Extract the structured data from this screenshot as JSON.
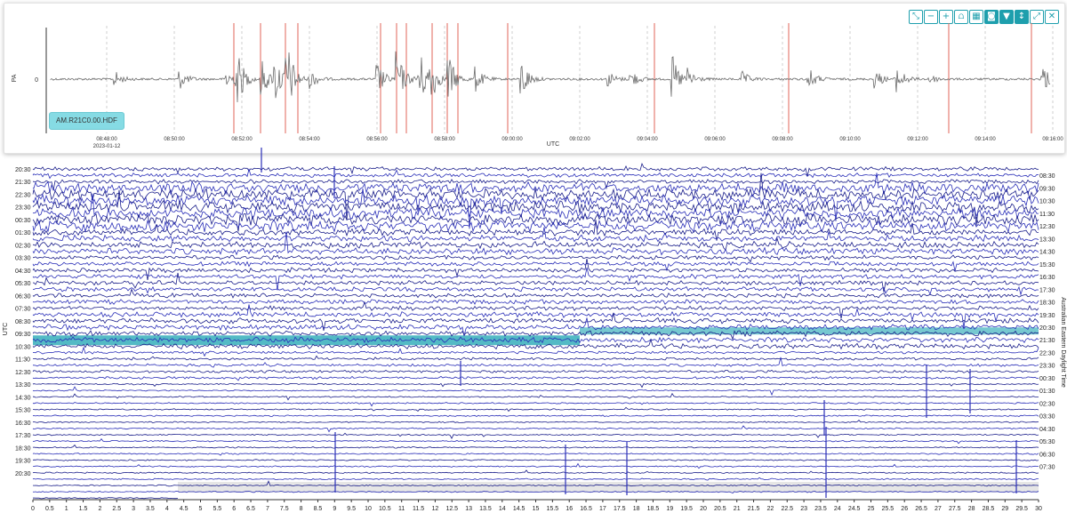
{
  "toolbar": {
    "buttons": [
      {
        "icon": "fit-icon",
        "glyph": "⤡",
        "active": false
      },
      {
        "icon": "zoom-out-icon",
        "glyph": "−",
        "active": false
      },
      {
        "icon": "zoom-in-icon",
        "glyph": "+",
        "active": false
      },
      {
        "icon": "chart-icon",
        "glyph": "⩍",
        "active": false
      },
      {
        "icon": "grid-icon",
        "glyph": "▦",
        "active": false
      },
      {
        "icon": "headphones-icon",
        "glyph": "◙",
        "active": true
      },
      {
        "icon": "filter-icon",
        "glyph": "▼",
        "active": true
      },
      {
        "icon": "vertical-scale-icon",
        "glyph": "↕",
        "active": true
      },
      {
        "icon": "expand-icon",
        "glyph": "⤢",
        "active": false
      },
      {
        "icon": "close-icon",
        "glyph": "✕",
        "active": false
      }
    ]
  },
  "trace": {
    "ylabel": "PA",
    "ytick": "0",
    "xlabel": "UTC",
    "station": "AM.R21C0.00.HDF",
    "date": "2023-01-12",
    "time_ticks": [
      "08:48:00",
      "08:50:00",
      "08:52:00",
      "08:54:00",
      "08:56:00",
      "08:58:00",
      "09:00:00",
      "09:02:00",
      "09:04:00",
      "09:06:00",
      "09:08:00",
      "09:10:00",
      "09:12:00",
      "09:14:00",
      "09:16:00"
    ],
    "colors": {
      "trace": "#6b6b6b",
      "event_line": "#e2645a",
      "grid": "#cfcfcf"
    }
  },
  "helicorder": {
    "left_axis_label": "UTC",
    "right_axis_label": "Australian Eastern Daylight Time",
    "left_labels": [
      "20:30",
      "21:30",
      "22:30",
      "23:30",
      "00:30",
      "01:30",
      "02:30",
      "03:30",
      "04:30",
      "05:30",
      "06:30",
      "07:30",
      "08:30",
      "09:30",
      "10:30",
      "11:30",
      "12:30",
      "13:30",
      "14:30",
      "15:30",
      "16:30",
      "17:30",
      "18:30",
      "19:30",
      "20:30"
    ],
    "right_labels": [
      "08:30",
      "09:30",
      "10:30",
      "11:30",
      "12:30",
      "13:30",
      "14:30",
      "15:30",
      "16:30",
      "17:30",
      "18:30",
      "19:30",
      "20:30",
      "21:30",
      "22:30",
      "23:30",
      "00:30",
      "01:30",
      "02:30",
      "03:30",
      "04:30",
      "05:30",
      "06:30",
      "07:30"
    ],
    "minute_ticks": [
      "0",
      "0.5",
      "1",
      "1.5",
      "2",
      "2.5",
      "3",
      "3.5",
      "4",
      "4.5",
      "5",
      "5.5",
      "6",
      "6.5",
      "7",
      "7.5",
      "8",
      "8.5",
      "9",
      "9.5",
      "10",
      "10.5",
      "11",
      "11.5",
      "12",
      "12.5",
      "13",
      "13.5",
      "14",
      "14.5",
      "15",
      "15.5",
      "16",
      "16.5",
      "17",
      "17.5",
      "18",
      "18.5",
      "19",
      "19.5",
      "20",
      "20.5",
      "21",
      "21.5",
      "22",
      "22.5",
      "23",
      "23.5",
      "24",
      "24.5",
      "25",
      "25.5",
      "26",
      "26.5",
      "27",
      "27.5",
      "28",
      "28.5",
      "29",
      "29.5",
      "30"
    ],
    "colors": {
      "trace": "#2a2fb8",
      "trace_dark": "#1a1e8a",
      "highlight": "#1aa3b1"
    }
  }
}
